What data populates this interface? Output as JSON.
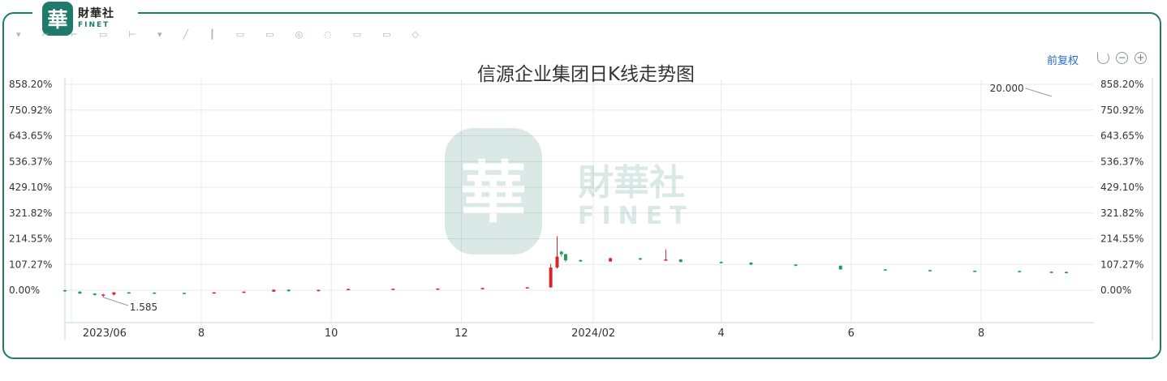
{
  "logo": {
    "mark": "華",
    "name_cn": "財華社",
    "name_en": "FINET"
  },
  "toolbar": {
    "icons": [
      "cursor-icon",
      "crosshair-icon",
      "trend-line-icon",
      "horizontal-line-icon",
      "ray-icon",
      "channel-icon",
      "fibonacci-icon",
      "text-icon",
      "rectangle-icon",
      "ellipse-icon",
      "measure-icon",
      "magnet-icon",
      "lock-icon",
      "eye-icon",
      "trash-icon"
    ]
  },
  "controls": {
    "restore_label": "前复权",
    "undo_icon": "undo-icon",
    "zoom_out_icon": "zoom-out-icon",
    "zoom_in_icon": "zoom-in-icon"
  },
  "watermark": {
    "mark": "華",
    "name_cn": "財華社",
    "name_en": "FINET"
  },
  "colors": {
    "up": "#d62728",
    "down": "#1e9e5e",
    "grid": "#e6e9ee",
    "frame": "#1f7a6c",
    "text": "#333333"
  },
  "chart_data": {
    "type": "candlestick",
    "title": "信源企业集团日K线走势图",
    "y_tick_labels": [
      "858.20%",
      "750.92%",
      "643.65%",
      "536.37%",
      "429.10%",
      "321.82%",
      "214.55%",
      "107.27%",
      "0.00%"
    ],
    "y_unit": "percent change",
    "y_range": [
      -120,
      858.2
    ],
    "x_tick_labels": [
      "2023/06",
      "8",
      "10",
      "12",
      "2024/02",
      "4",
      "6",
      "8"
    ],
    "x_range": [
      "2023-05-29",
      "2024-09-10"
    ],
    "annotations": [
      {
        "label": "1.585",
        "date": "2023-06-20",
        "value": -30
      },
      {
        "label": "20.000",
        "date": "2024-09-03",
        "value": 808
      }
    ],
    "candles": [
      {
        "date": "2023-05-29",
        "open": 0,
        "high": 2,
        "low": -3,
        "close": -1
      },
      {
        "date": "2023-06-05",
        "open": -6,
        "high": -4,
        "low": -15,
        "close": -14
      },
      {
        "date": "2023-06-12",
        "open": -14,
        "high": -12,
        "low": -22,
        "close": -20
      },
      {
        "date": "2023-06-16",
        "open": -20,
        "high": -15,
        "low": -30,
        "close": -18
      },
      {
        "date": "2023-06-21",
        "open": -18,
        "high": -8,
        "low": -22,
        "close": -9
      },
      {
        "date": "2023-06-28",
        "open": -9,
        "high": -7,
        "low": -12,
        "close": -10
      },
      {
        "date": "2023-07-10",
        "open": -10,
        "high": -8,
        "low": -13,
        "close": -11
      },
      {
        "date": "2023-07-24",
        "open": -11,
        "high": -10,
        "low": -14,
        "close": -13
      },
      {
        "date": "2023-08-07",
        "open": -13,
        "high": -8,
        "low": -14,
        "close": -9
      },
      {
        "date": "2023-08-21",
        "open": -9,
        "high": -5,
        "low": -10,
        "close": -6
      },
      {
        "date": "2023-09-04",
        "open": -6,
        "high": 3,
        "low": -7,
        "close": 2
      },
      {
        "date": "2023-09-11",
        "open": 2,
        "high": 4,
        "low": -6,
        "close": -4
      },
      {
        "date": "2023-09-25",
        "open": -4,
        "high": 2,
        "low": -5,
        "close": 1
      },
      {
        "date": "2023-10-09",
        "open": 1,
        "high": 6,
        "low": 0,
        "close": 5
      },
      {
        "date": "2023-10-30",
        "open": 5,
        "high": 7,
        "low": 4,
        "close": 6
      },
      {
        "date": "2023-11-20",
        "open": 6,
        "high": 8,
        "low": 5,
        "close": 7
      },
      {
        "date": "2023-12-11",
        "open": 7,
        "high": 10,
        "low": 6,
        "close": 9
      },
      {
        "date": "2024-01-01",
        "open": 9,
        "high": 13,
        "low": 8,
        "close": 12
      },
      {
        "date": "2024-01-12",
        "open": 12,
        "high": 110,
        "low": 10,
        "close": 95
      },
      {
        "date": "2024-01-15",
        "open": 95,
        "high": 225,
        "low": 90,
        "close": 140
      },
      {
        "date": "2024-01-17",
        "open": 160,
        "high": 165,
        "low": 140,
        "close": 150
      },
      {
        "date": "2024-01-19",
        "open": 150,
        "high": 152,
        "low": 118,
        "close": 125
      },
      {
        "date": "2024-01-26",
        "open": 125,
        "high": 128,
        "low": 118,
        "close": 120
      },
      {
        "date": "2024-02-09",
        "open": 120,
        "high": 136,
        "low": 118,
        "close": 133
      },
      {
        "date": "2024-02-23",
        "open": 133,
        "high": 135,
        "low": 126,
        "close": 128
      },
      {
        "date": "2024-03-06",
        "open": 128,
        "high": 170,
        "low": 125,
        "close": 128
      },
      {
        "date": "2024-03-13",
        "open": 128,
        "high": 130,
        "low": 116,
        "close": 118
      },
      {
        "date": "2024-04-01",
        "open": 118,
        "high": 120,
        "low": 112,
        "close": 115
      },
      {
        "date": "2024-04-15",
        "open": 115,
        "high": 117,
        "low": 105,
        "close": 107
      },
      {
        "date": "2024-05-06",
        "open": 107,
        "high": 108,
        "low": 100,
        "close": 102
      },
      {
        "date": "2024-05-27",
        "open": 102,
        "high": 103,
        "low": 85,
        "close": 87
      },
      {
        "date": "2024-06-17",
        "open": 87,
        "high": 88,
        "low": 82,
        "close": 84
      },
      {
        "date": "2024-07-08",
        "open": 84,
        "high": 85,
        "low": 80,
        "close": 81
      },
      {
        "date": "2024-07-29",
        "open": 81,
        "high": 82,
        "low": 78,
        "close": 80
      },
      {
        "date": "2024-08-19",
        "open": 80,
        "high": 81,
        "low": 75,
        "close": 77
      },
      {
        "date": "2024-09-03",
        "open": 77,
        "high": 79,
        "low": 72,
        "close": 76
      },
      {
        "date": "2024-09-10",
        "open": 76,
        "high": 78,
        "low": 73,
        "close": 75
      }
    ]
  }
}
